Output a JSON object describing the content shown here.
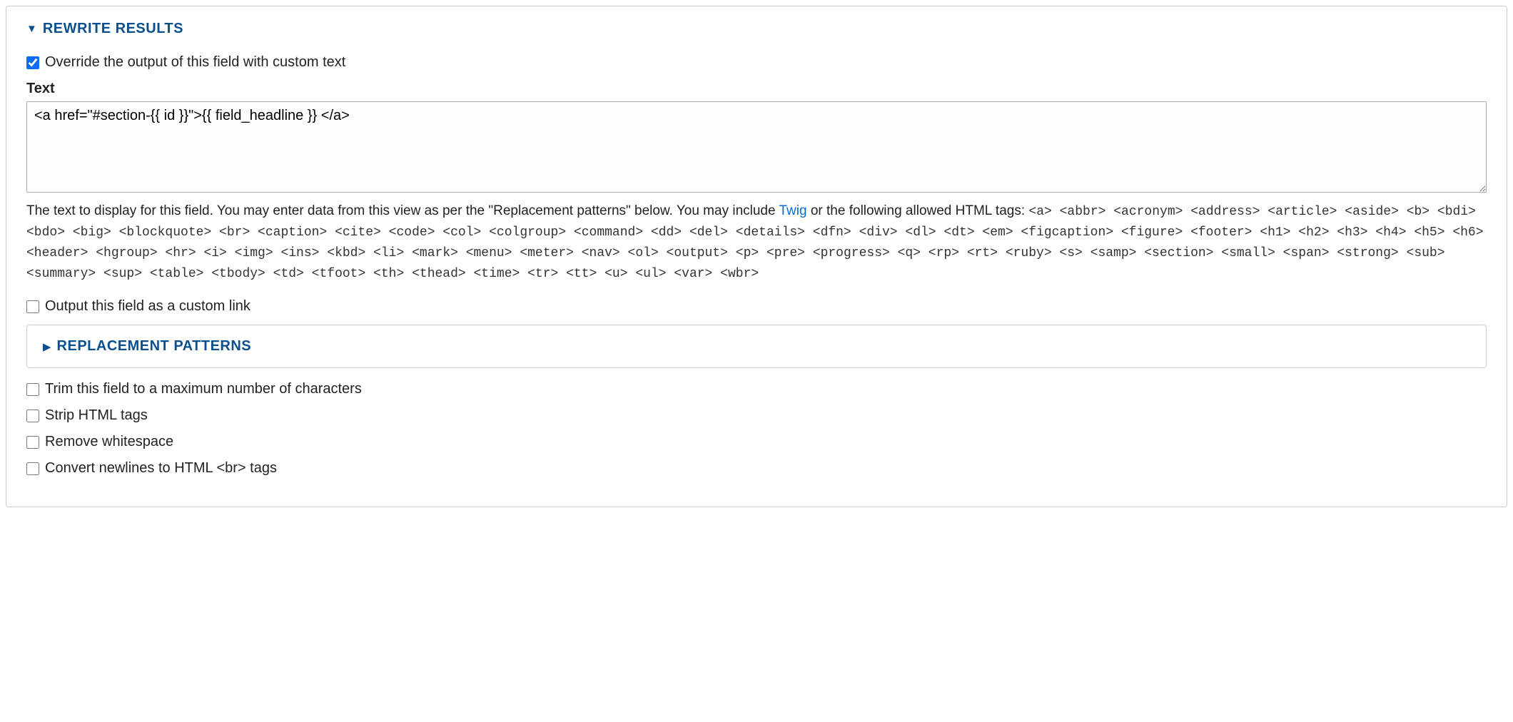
{
  "section": {
    "title": "REWRITE RESULTS"
  },
  "override": {
    "label": "Override the output of this field with custom text",
    "checked": true
  },
  "textField": {
    "label": "Text",
    "value": "<a href=\"#section-{{ id }}\">{{ field_headline }} </a>"
  },
  "description": {
    "prefix": "The text to display for this field. You may enter data from this view as per the \"Replacement patterns\" below. You may include ",
    "twigLink": "Twig",
    "middle": " or the following allowed HTML tags: ",
    "allowedTags": "<a> <abbr> <acronym> <address> <article> <aside> <b> <bdi> <bdo> <big> <blockquote> <br> <caption> <cite> <code> <col> <colgroup> <command> <dd> <del> <details> <dfn> <div> <dl> <dt> <em> <figcaption> <figure> <footer> <h1> <h2> <h3> <h4> <h5> <h6> <header> <hgroup> <hr> <i> <img> <ins> <kbd> <li> <mark> <menu> <meter> <nav> <ol> <output> <p> <pre> <progress> <q> <rp> <rt> <ruby> <s> <samp> <section> <small> <span> <strong> <sub> <summary> <sup> <table> <tbody> <td> <tfoot> <th> <thead> <time> <tr> <tt> <u> <ul> <var> <wbr>"
  },
  "customLink": {
    "label": "Output this field as a custom link",
    "checked": false
  },
  "replacementPatterns": {
    "title": "REPLACEMENT PATTERNS"
  },
  "trim": {
    "label": "Trim this field to a maximum number of characters",
    "checked": false
  },
  "stripHtml": {
    "label": "Strip HTML tags",
    "checked": false
  },
  "removeWhitespace": {
    "label": "Remove whitespace",
    "checked": false
  },
  "convertNewlines": {
    "label": "Convert newlines to HTML <br> tags",
    "checked": false
  }
}
